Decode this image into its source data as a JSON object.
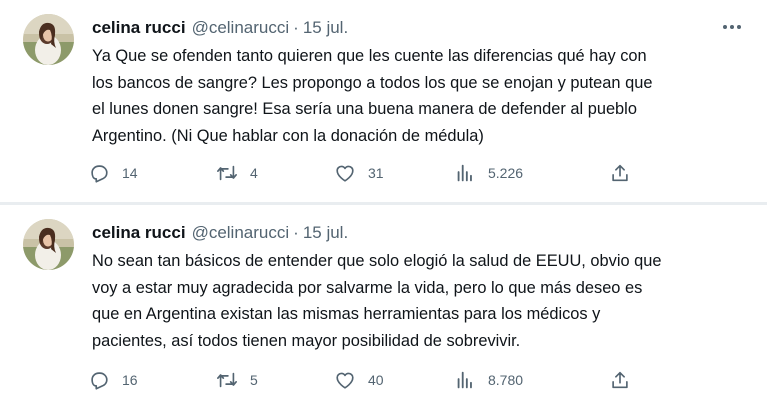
{
  "tweets": [
    {
      "author_name": "celina rucci",
      "handle": "@celinarucci",
      "separator": "·",
      "date": "15 jul.",
      "lines": [
        "Ya Que se ofenden tanto quieren que les cuente las diferencias qué hay con",
        "los bancos de sangre? Les propongo a todos los que se enojan y putean que",
        "el lunes donen sangre! Esa sería una buena manera de defender al pueblo",
        "Argentino. (Ni Que hablar con la donación de médula)"
      ],
      "replies": "14",
      "retweets": "4",
      "likes": "31",
      "views": "5.226"
    },
    {
      "author_name": "celina rucci",
      "handle": "@celinarucci",
      "separator": "·",
      "date": "15 jul.",
      "lines": [
        "No sean tan básicos de entender que solo elogió la salud de EEUU, obvio que",
        "voy a estar muy agradecida por salvarme la vida, pero lo que más deseo es",
        "que en Argentina existan las mismas herramientas para los médicos y",
        "pacientes, así todos tienen mayor posibilidad de sobrevivir."
      ],
      "replies": "16",
      "retweets": "5",
      "likes": "40",
      "views": "8.780"
    }
  ],
  "icons": {
    "reply": "reply-icon",
    "retweet": "retweet-icon",
    "like": "heart-icon",
    "views": "analytics-icon",
    "share": "share-icon",
    "more": "more-options-icon"
  },
  "colors": {
    "text": "#0f1419",
    "secondary": "#536471",
    "divider": "#e9edf0",
    "background": "#ffffff"
  }
}
